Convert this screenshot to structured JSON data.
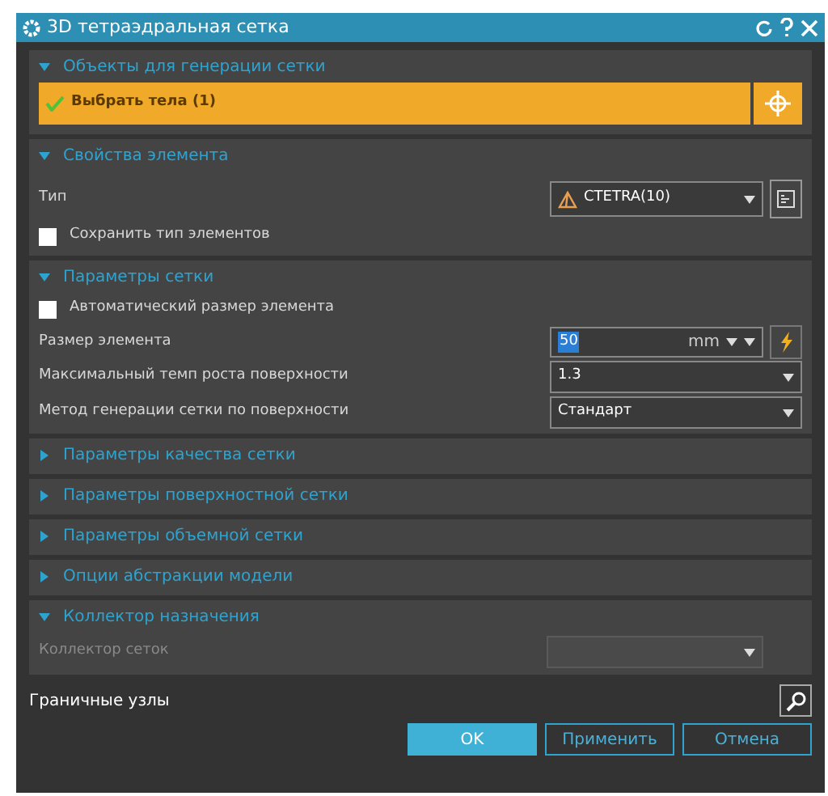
{
  "window": {
    "title": "3D тетраэдральная сетка"
  },
  "sections": [
    {
      "title": "Объекты для генерации сетки",
      "expanded": true,
      "rows": [
        {
          "kind": "selector",
          "label": "Выбрать тела (1)",
          "checked": true
        }
      ]
    },
    {
      "title": "Свойства элемента",
      "expanded": true,
      "rows": [
        {
          "kind": "type",
          "label": "Тип",
          "value": "CTETRA(10)"
        },
        {
          "kind": "checkbox",
          "label": "Сохранить тип элементов",
          "checked": false
        }
      ]
    },
    {
      "title": "Параметры сетки",
      "expanded": true,
      "rows": [
        {
          "kind": "checkbox",
          "label": "Автоматический размер элемента",
          "checked": false
        },
        {
          "kind": "size",
          "label": "Размер элемента",
          "value": "50",
          "unit": "mm"
        },
        {
          "kind": "dropdown",
          "label": "Максимальный темп роста поверхности",
          "value": "1.3"
        },
        {
          "kind": "dropdown",
          "label": "Метод генерации сетки по поверхности",
          "value": "Стандарт"
        }
      ]
    },
    {
      "title": "Параметры качества сетки",
      "expanded": false
    },
    {
      "title": "Параметры поверхностной сетки",
      "expanded": false
    },
    {
      "title": "Параметры объемной сетки",
      "expanded": false
    },
    {
      "title": "Опции абстракции модели",
      "expanded": false
    },
    {
      "title": "Коллектор назначения",
      "expanded": true,
      "rows": [
        {
          "kind": "disabled-dropdown",
          "label": "Коллектор сеток"
        }
      ]
    }
  ],
  "boundary": {
    "label": "Граничные узлы"
  },
  "buttons": [
    {
      "label": "OK",
      "primary": true
    },
    {
      "label": "Применить",
      "primary": false
    },
    {
      "label": "Отмена",
      "primary": false
    }
  ]
}
